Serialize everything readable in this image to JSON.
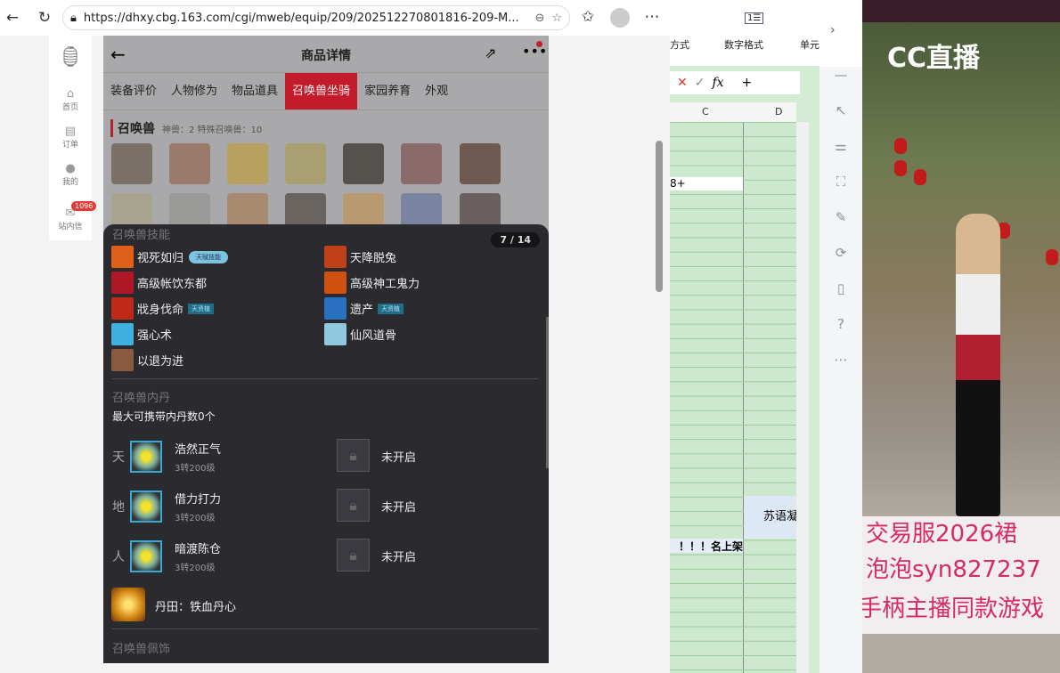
{
  "browser": {
    "url": "https://dhxy.cbg.163.com/cgi/mweb/equip/209/202512270801816-209-M..."
  },
  "sidebar": {
    "items": [
      {
        "label": "首页"
      },
      {
        "label": "订单"
      },
      {
        "label": "我的"
      },
      {
        "label": "站内信"
      }
    ],
    "badge": "1096"
  },
  "page": {
    "title": "商品详情",
    "tabs": [
      "装备评价",
      "人物修为",
      "物品道具",
      "召唤兽坐骑",
      "家园养育",
      "外观"
    ],
    "pets": {
      "heading": "召唤兽",
      "summary": "神兽：2  特殊召唤兽：10"
    },
    "skills": {
      "heading": "召唤兽技能",
      "pager": "7 / 14",
      "items": [
        {
          "name": "视死如归",
          "tag": "天赋技能"
        },
        {
          "name": "天降脱兔"
        },
        {
          "name": "高级帐饮东都"
        },
        {
          "name": "高级神工鬼力"
        },
        {
          "name": "戕身伐命",
          "tag": "天资植"
        },
        {
          "name": "遗产",
          "tag": "天资植"
        },
        {
          "name": "强心术"
        },
        {
          "name": "仙风道骨"
        },
        {
          "name": "以退为进"
        }
      ]
    },
    "neidan": {
      "heading": "召唤兽内丹",
      "max": "最大可携带内丹数0个",
      "rows": [
        {
          "slot": "天",
          "name": "浩然正气",
          "level": "3转200级",
          "locked": "未开启"
        },
        {
          "slot": "地",
          "name": "借力打力",
          "level": "3转200级",
          "locked": "未开启"
        },
        {
          "slot": "人",
          "name": "暗渡陈仓",
          "level": "3转200级",
          "locked": "未开启"
        }
      ],
      "dantian": "丹田：铁血丹心"
    },
    "accessory": {
      "heading": "召唤兽佩饰"
    }
  },
  "sheet": {
    "ribbon": [
      "方式",
      "数字格式",
      "单元"
    ],
    "cols": [
      "C",
      "D"
    ],
    "cells": [
      "8+",
      "苏语凝",
      "名上架！！！"
    ]
  },
  "stream": {
    "logo": "CC直播",
    "captions": [
      "交易服2026裙",
      "泡泡syn827237",
      "手柄主播同款游戏"
    ]
  }
}
